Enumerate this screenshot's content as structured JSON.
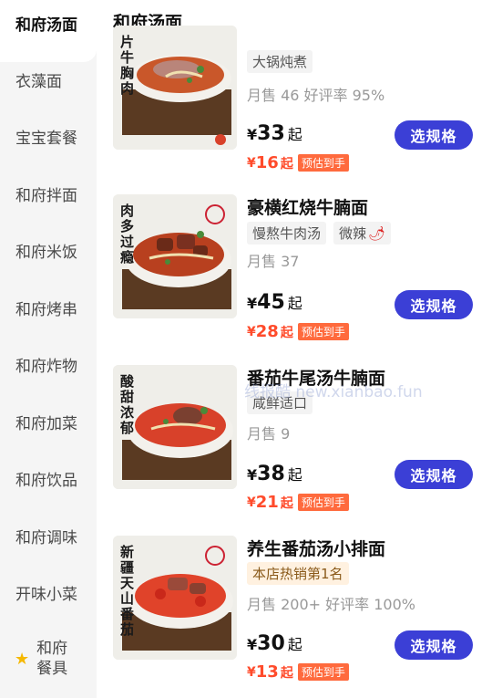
{
  "sidebar": {
    "items": [
      {
        "label": "和府汤面"
      },
      {
        "label": "衣藻面"
      },
      {
        "label": "宝宝套餐"
      },
      {
        "label": "和府拌面"
      },
      {
        "label": "和府米饭"
      },
      {
        "label": "和府烤串"
      },
      {
        "label": "和府炸物"
      },
      {
        "label": "和府加菜"
      },
      {
        "label": "和府饮品"
      },
      {
        "label": "和府调味"
      },
      {
        "label": "开味小菜"
      }
    ],
    "tableware": {
      "line1": "和府",
      "line2": "餐具",
      "icon": "star-icon"
    }
  },
  "main": {
    "section_title": "和府汤面",
    "watermark": "线报酷 new.xianbao.fun",
    "products": [
      {
        "thumb_caption": "片牛胸肉",
        "name": "",
        "tags": [
          "大锅炖煮"
        ],
        "sales": "月售 46 好评率 95%",
        "currency": "¥",
        "price": "33",
        "price_suffix": "起",
        "est_price": "16",
        "est_badge": "预估到手",
        "button": "选规格",
        "soup_color": "#c9572a"
      },
      {
        "thumb_caption": "肉多过瘾",
        "name": "豪横红烧牛腩面",
        "tags": [
          "慢熬牛肉汤",
          "微辣"
        ],
        "sales": "月售 37",
        "currency": "¥",
        "price": "45",
        "price_suffix": "起",
        "est_price": "28",
        "est_badge": "预估到手",
        "button": "选规格",
        "soup_color": "#b8401f"
      },
      {
        "thumb_caption": "酸甜浓郁",
        "name": "番茄牛尾汤牛腩面",
        "tags": [
          "咸鲜适口"
        ],
        "sales": "月售 9",
        "currency": "¥",
        "price": "38",
        "price_suffix": "起",
        "est_price": "21",
        "est_badge": "预估到手",
        "button": "选规格",
        "soup_color": "#d8412a"
      },
      {
        "thumb_caption": "新疆天山番茄",
        "name": "养生番茄汤小排面",
        "tags": [
          "本店热销第1名"
        ],
        "sales": "月售 200+ 好评率 100%",
        "currency": "¥",
        "price": "30",
        "price_suffix": "起",
        "est_price": "13",
        "est_badge": "预估到手",
        "button": "选规格",
        "soup_color": "#e0432a"
      }
    ]
  }
}
